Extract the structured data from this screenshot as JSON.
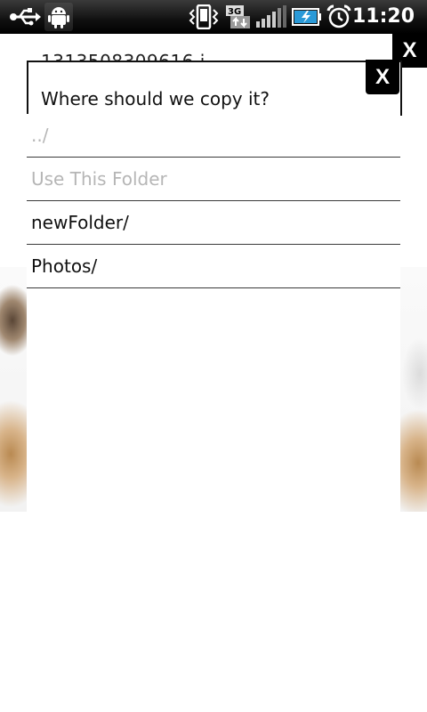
{
  "status_bar": {
    "time": "11:20",
    "network_type": "3G",
    "icons": [
      "usb-icon",
      "android-debug-icon",
      "vibrate-icon",
      "3g-data-icon",
      "signal-icon",
      "battery-charging-icon",
      "alarm-icon"
    ]
  },
  "background_dialog": {
    "filename_partial": "1313508309616.j",
    "close_label": "X"
  },
  "copy_dialog": {
    "title": "Where should we copy it?",
    "close_label": "X",
    "items": [
      {
        "label": "../",
        "enabled": false
      },
      {
        "label": "Use This Folder",
        "enabled": false
      },
      {
        "label": "newFolder/",
        "enabled": true
      },
      {
        "label": "Photos/",
        "enabled": true
      }
    ]
  },
  "colors": {
    "status_bar_bg": "#000000",
    "disabled_text": "#b6b6b6",
    "text": "#111111",
    "divider": "#3a3a3a",
    "close_bg": "#000000"
  }
}
